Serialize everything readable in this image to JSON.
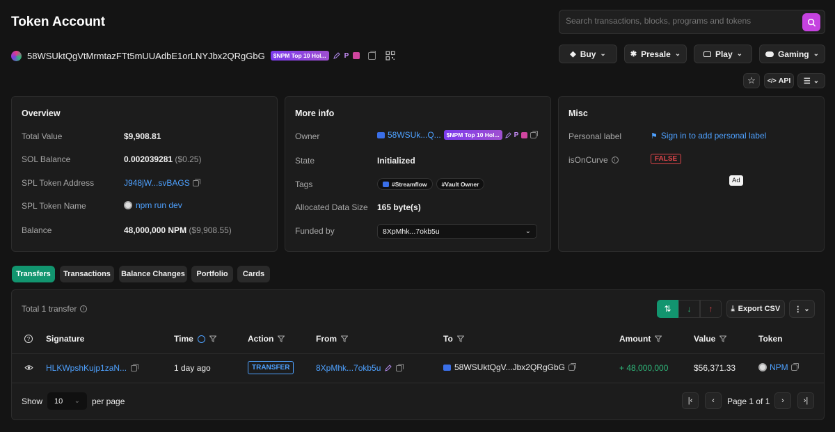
{
  "page_title": "Token Account",
  "search": {
    "placeholder": "Search transactions, blocks, programs and tokens"
  },
  "address": {
    "full": "58WSUktQgVtMrmtazFTt5mUUAdbE1orLNYJbx2QRgGbG",
    "badge": "$NPM Top 10 Hol...",
    "badge_p": "P"
  },
  "nav": {
    "buy": "Buy",
    "presale": "Presale",
    "play": "Play",
    "gaming": "Gaming",
    "api": "API"
  },
  "overview": {
    "title": "Overview",
    "total_value_label": "Total Value",
    "total_value": "$9,908.81",
    "sol_balance_label": "SOL Balance",
    "sol_balance": "0.002039281",
    "sol_balance_usd": "($0.25)",
    "spl_address_label": "SPL Token Address",
    "spl_address": "J948jW...svBAGS",
    "spl_name_label": "SPL Token Name",
    "spl_name": "npm run dev",
    "balance_label": "Balance",
    "balance": "48,000,000 NPM",
    "balance_usd": "($9,908.55)"
  },
  "more_info": {
    "title": "More info",
    "owner_label": "Owner",
    "owner": "58WSUk...Q...",
    "owner_badge": "$NPM Top 10 Hol...",
    "owner_p": "P",
    "state_label": "State",
    "state": "Initialized",
    "tags_label": "Tags",
    "tag1": "#Streamflow",
    "tag2": "#Vault Owner",
    "data_size_label": "Allocated Data Size",
    "data_size": "165 byte(s)",
    "funded_label": "Funded by",
    "funded_by": "8XpMhk...7okb5u"
  },
  "misc": {
    "title": "Misc",
    "personal_label": "Personal label",
    "sign_in": "Sign in to add personal label",
    "on_curve_label": "isOnCurve",
    "on_curve": "FALSE",
    "ad": "Ad"
  },
  "tabs": [
    "Transfers",
    "Transactions",
    "Balance Changes",
    "Portfolio",
    "Cards"
  ],
  "transfers": {
    "total": "Total 1 transfer",
    "export": "Export CSV",
    "headers": {
      "signature": "Signature",
      "time": "Time",
      "action": "Action",
      "from": "From",
      "to": "To",
      "amount": "Amount",
      "value": "Value",
      "token": "Token"
    },
    "rows": [
      {
        "signature": "HLKWpshKujp1zaN...",
        "time": "1 day ago",
        "action": "TRANSFER",
        "from": "8XpMhk...7okb5u",
        "to": "58WSUktQgV...Jbx2QRgGbG",
        "amount": "+ 48,000,000",
        "value": "$56,371.33",
        "token": "NPM"
      }
    ],
    "show_label": "Show",
    "per_page_value": "10",
    "per_page_label": "per page",
    "page_text": "Page 1 of 1"
  },
  "colors": {
    "accent_green": "#12956f",
    "link_blue": "#4ea1ff",
    "search_button": "#c542e0",
    "false_red": "#e0454a"
  }
}
